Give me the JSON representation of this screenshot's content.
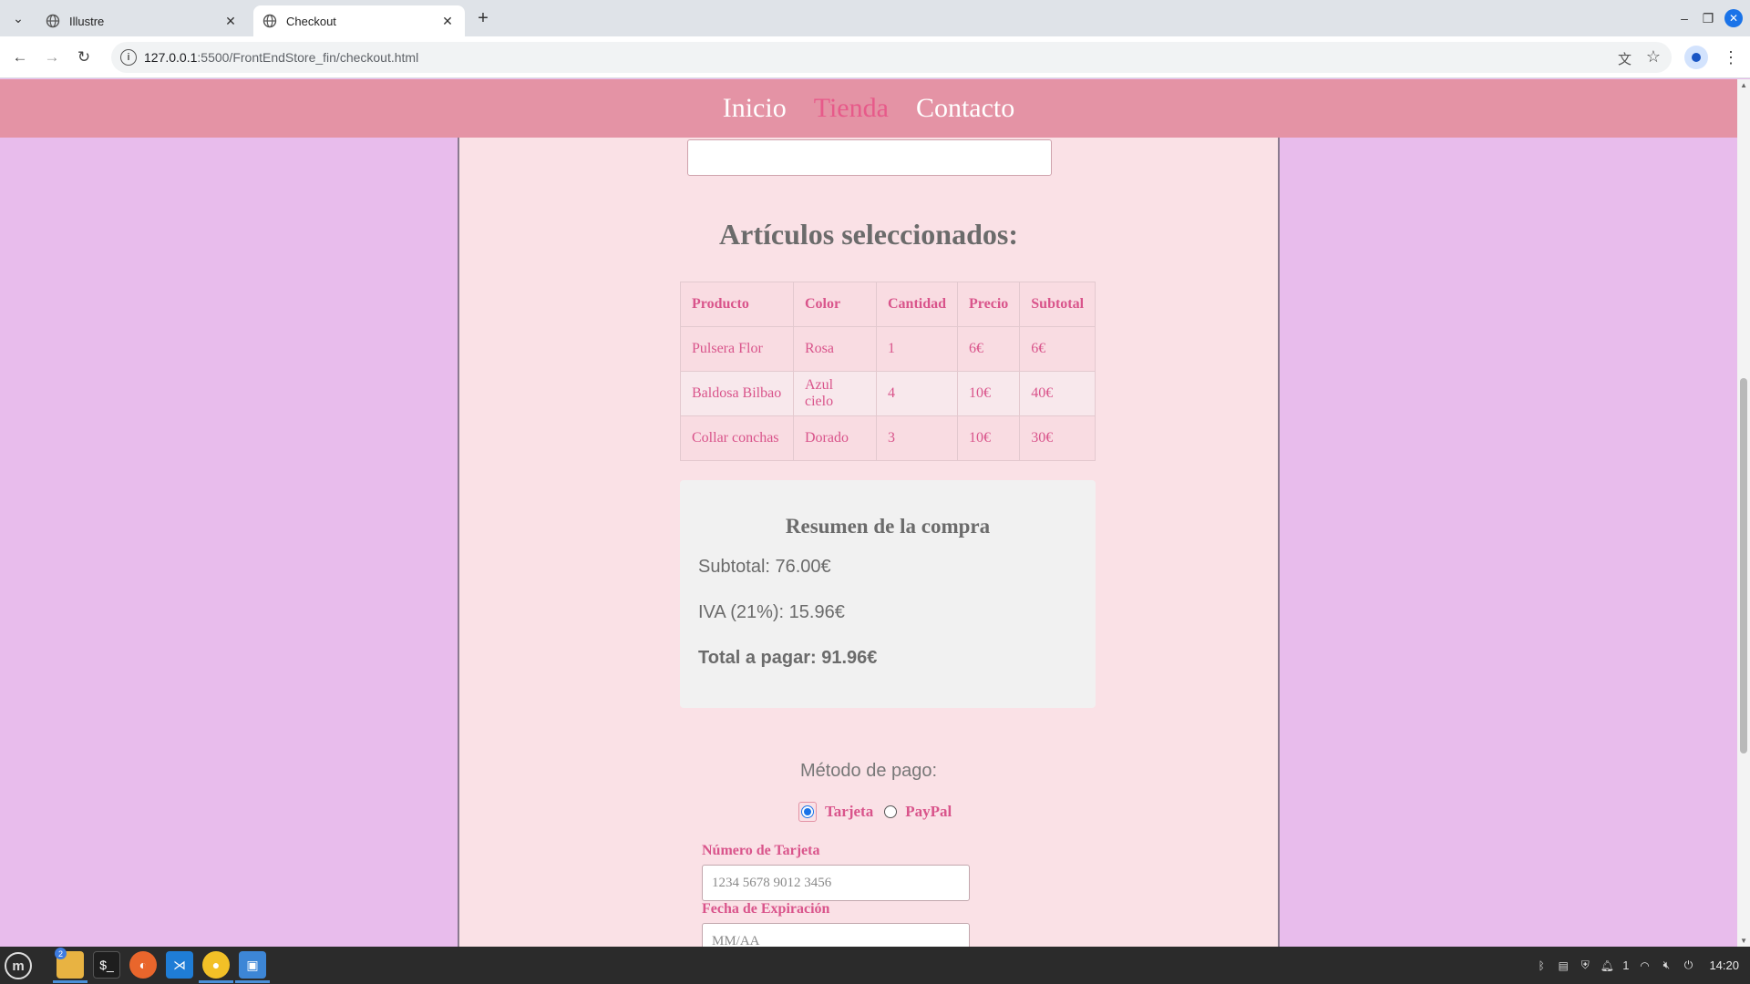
{
  "browser": {
    "tabs": [
      {
        "title": "Illustre",
        "active": false
      },
      {
        "title": "Checkout",
        "active": true
      }
    ],
    "url_host": "127.0.0.1",
    "url_rest": ":5500/FrontEndStore_fin/checkout.html"
  },
  "site_nav": {
    "items": [
      "Inicio",
      "Tienda",
      "Contacto"
    ],
    "current": "Tienda"
  },
  "cart": {
    "title": "Artículos seleccionados:",
    "columns": [
      "Producto",
      "Color",
      "Cantidad",
      "Precio",
      "Subtotal"
    ],
    "rows": [
      {
        "producto": "Pulsera Flor",
        "color": "Rosa",
        "cantidad": "1",
        "precio": "6€",
        "subtotal": "6€"
      },
      {
        "producto": "Baldosa Bilbao",
        "color": "Azul cielo",
        "cantidad": "4",
        "precio": "10€",
        "subtotal": "40€"
      },
      {
        "producto": "Collar conchas",
        "color": "Dorado",
        "cantidad": "3",
        "precio": "10€",
        "subtotal": "30€"
      }
    ]
  },
  "summary": {
    "title": "Resumen de la compra",
    "subtotal": "Subtotal: 76.00€",
    "iva": "IVA (21%): 15.96€",
    "total": "Total a pagar: 91.96€"
  },
  "payment": {
    "label": "Método de pago:",
    "options": [
      "Tarjeta",
      "PayPal"
    ],
    "selected": "Tarjeta",
    "card_number_label": "Número de Tarjeta",
    "card_number_placeholder": "1234 5678 9012 3456",
    "expiry_label": "Fecha de Expiración",
    "expiry_placeholder": "MM/AA"
  },
  "taskbar": {
    "files_badge": "2",
    "tray_count": "1",
    "clock": "14:20"
  },
  "colors": {
    "page_bg": "#e8bcec",
    "nav_bg": "#e493a5",
    "card_bg": "#fae1e6",
    "accent_pink": "#d9548b"
  }
}
